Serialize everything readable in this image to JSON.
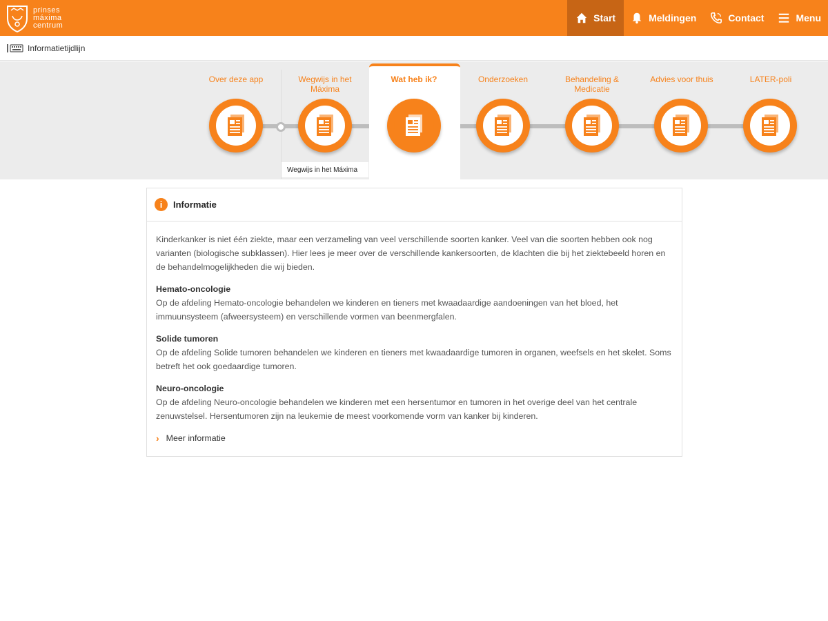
{
  "header": {
    "logo_lines": [
      "prinses",
      "máxima",
      "centrum"
    ],
    "nav": [
      {
        "label": "Start",
        "icon": "home-icon",
        "active": true
      },
      {
        "label": "Meldingen",
        "icon": "bell-icon",
        "active": false
      },
      {
        "label": "Contact",
        "icon": "phone-icon",
        "active": false
      },
      {
        "label": "Menu",
        "icon": "hamburger-icon",
        "active": false
      }
    ]
  },
  "breadcrumb": {
    "label": "Informatietijdlijn",
    "icon": "keyboard-icon"
  },
  "timeline": {
    "steps": [
      {
        "label": "Over deze app",
        "active": false
      },
      {
        "label": "Wegwijs in het Máxima",
        "active": false
      },
      {
        "label": "Wat heb ik?",
        "active": true
      },
      {
        "label": "Onderzoeken",
        "active": false
      },
      {
        "label": "Behandeling & Medicatie",
        "active": false
      },
      {
        "label": "Advies voor thuis",
        "active": false
      },
      {
        "label": "LATER-poli",
        "active": false
      }
    ],
    "tooltip": "Wegwijs in het Máxima"
  },
  "panel": {
    "title": "Informatie",
    "intro": "Kinderkanker is niet één ziekte, maar een verzameling van veel verschillende soorten kanker. Veel van die soorten hebben ook nog varianten (biologische subklassen). Hier lees je meer over de verschillende kankersoorten, de klachten die bij het ziektebeeld horen en de behandelmogelijkheden die wij bieden.",
    "sections": [
      {
        "title": "Hemato-oncologie",
        "text": "Op de afdeling Hemato-oncologie behandelen we kinderen en tieners met kwaadaardige aandoeningen van het bloed, het immuunsysteem (afweersysteem) en verschillende vormen van beenmergfalen."
      },
      {
        "title": "Solide tumoren",
        "text": "Op de afdeling Solide tumoren behandelen we kinderen en tieners met kwaadaardige tumoren in organen, weefsels en het skelet. Soms betreft het ook goedaardige tumoren."
      },
      {
        "title": "Neuro-oncologie",
        "text": "Op de afdeling Neuro-oncologie behandelen we kinderen met een hersentumor en tumoren in het overige deel van het centrale zenuwstelsel. Hersentumoren zijn na leukemie de meest voorkomende vorm van kanker bij kinderen."
      }
    ],
    "more_link": "Meer informatie"
  },
  "colors": {
    "accent": "#f7821b",
    "accent_dark": "#c76515",
    "band": "#ececec",
    "connector": "#bdbdbd"
  }
}
